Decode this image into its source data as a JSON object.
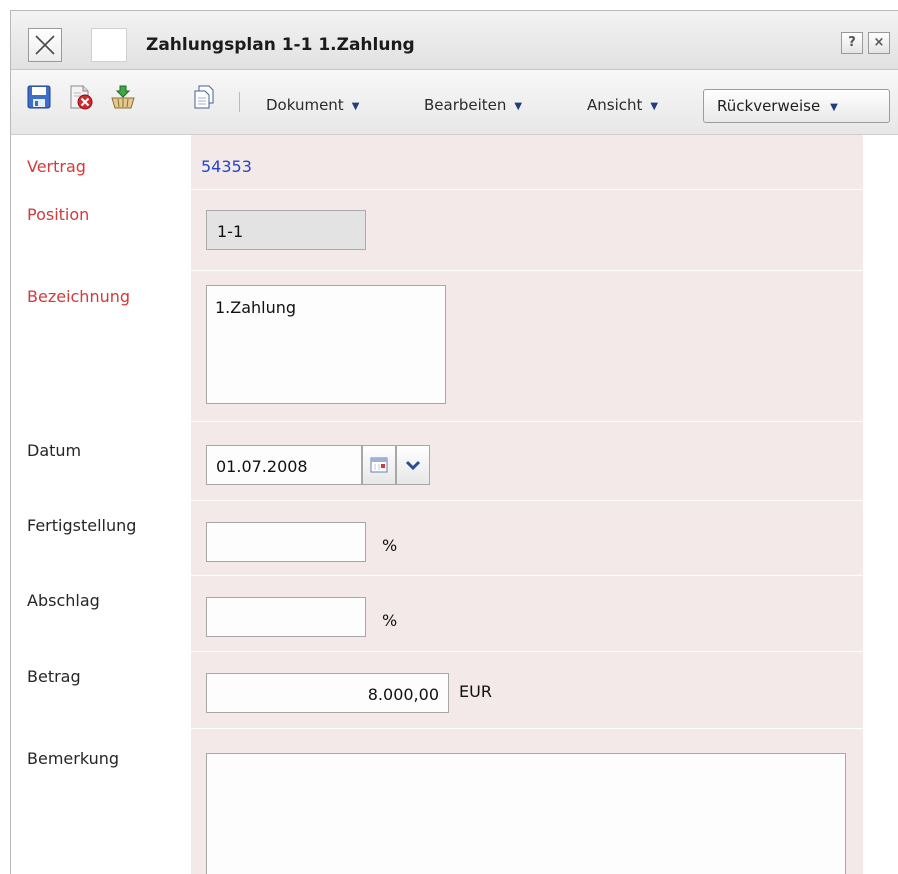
{
  "window": {
    "title": "Zahlungsplan 1-1 1.Zahlung",
    "help_glyph": "?",
    "close_glyph": "×"
  },
  "toolbar": {
    "icons": [
      "save-icon",
      "delete-document-icon",
      "basket-icon",
      "copy-icon"
    ],
    "menus": {
      "dokument": "Dokument",
      "bearbeiten": "Bearbeiten",
      "ansicht": "Ansicht",
      "rueckverweise": "Rückverweise"
    },
    "arrow": "▼"
  },
  "form": {
    "vertrag": {
      "label": "Vertrag",
      "value": "54353"
    },
    "position": {
      "label": "Position",
      "value": "1-1"
    },
    "bezeichnung": {
      "label": "Bezeichnung",
      "value": "1.Zahlung"
    },
    "datum": {
      "label": "Datum",
      "value": "01.07.2008"
    },
    "fertigstellung": {
      "label": "Fertigstellung",
      "value": "",
      "unit": "%"
    },
    "abschlag": {
      "label": "Abschlag",
      "value": "",
      "unit": "%"
    },
    "betrag": {
      "label": "Betrag",
      "value": "8.000,00",
      "unit": "EUR"
    },
    "bemerkung": {
      "label": "Bemerkung",
      "value": ""
    }
  },
  "colors": {
    "required_label": "#d33a3a",
    "link": "#2346c8",
    "field_bg": "#f4e9e9"
  }
}
